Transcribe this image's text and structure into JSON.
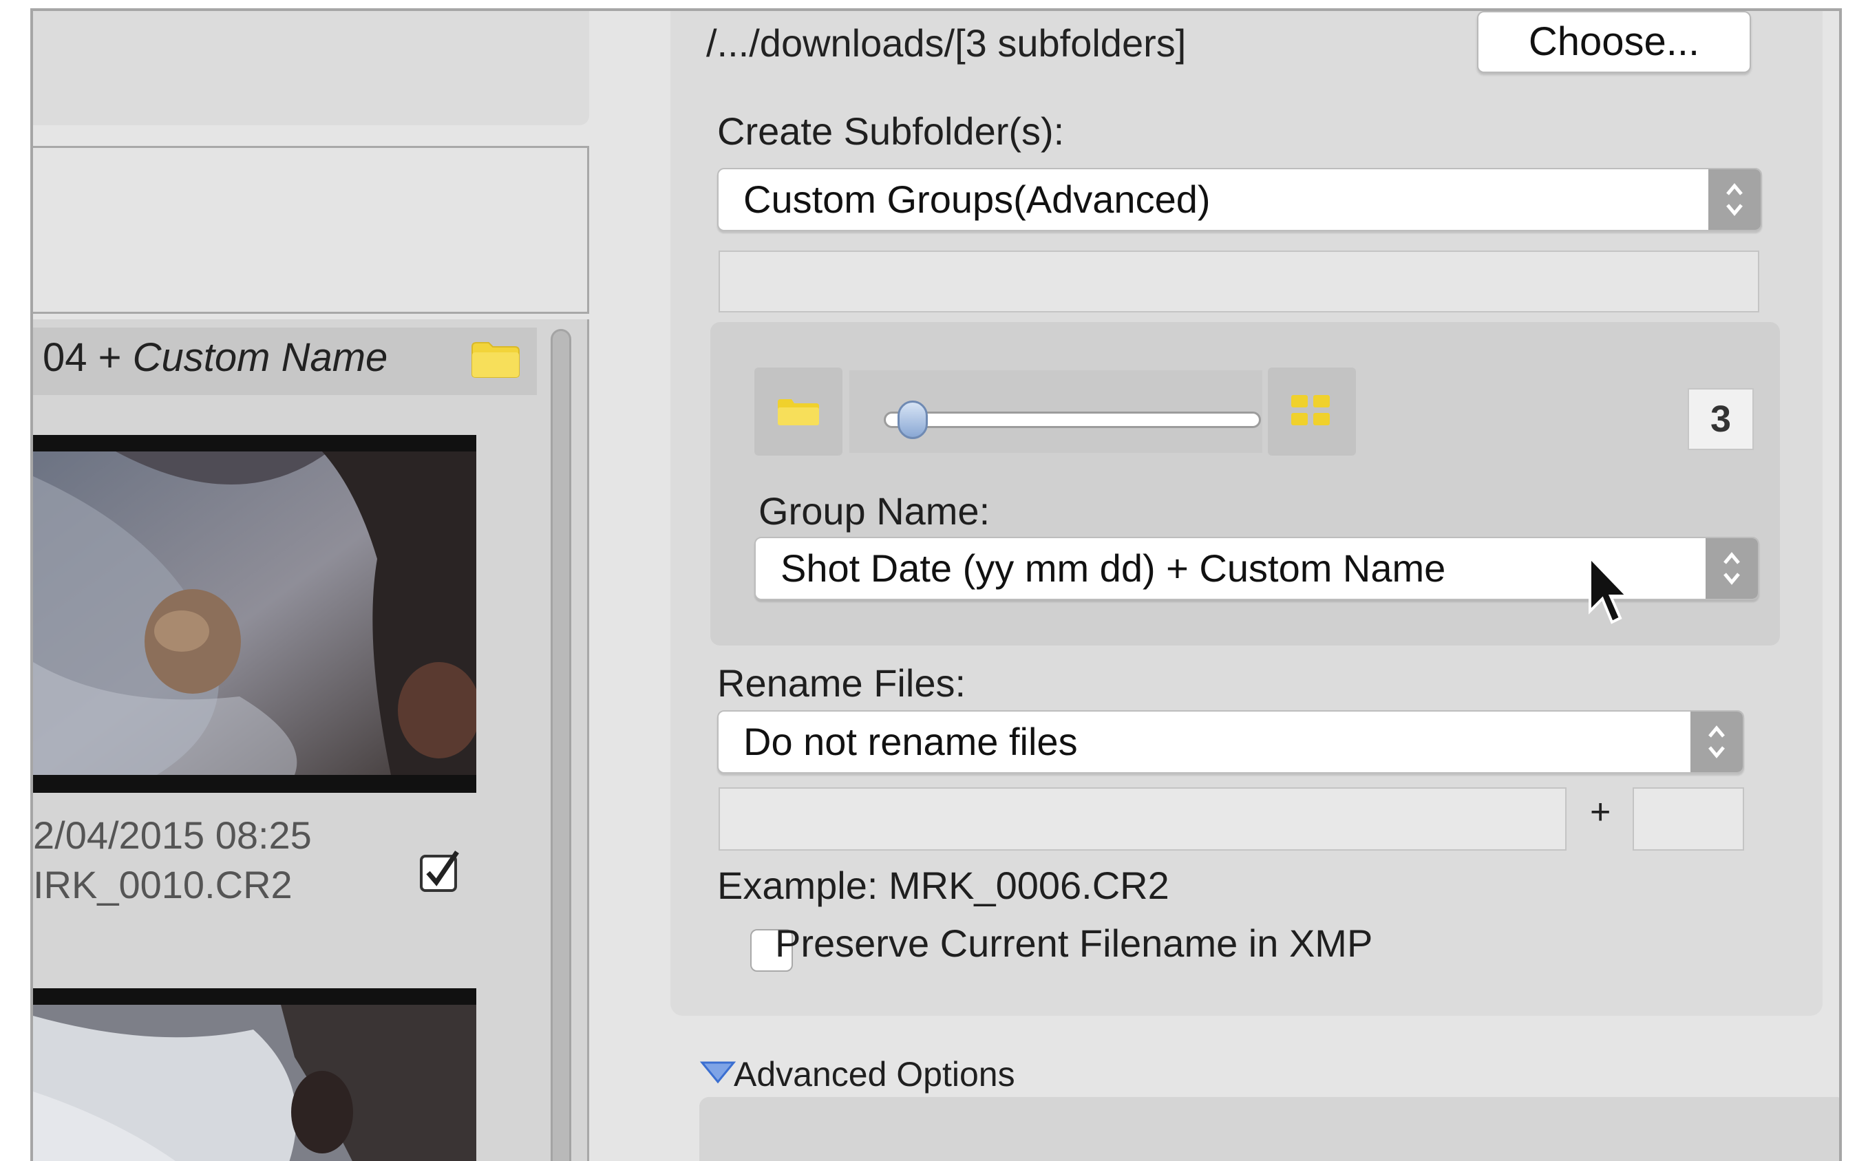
{
  "left_panel": {
    "group_header": {
      "date_fragment": "04",
      "separator": "+",
      "custom_name": "Custom Name",
      "icon": "folder-icon"
    },
    "items": [
      {
        "date_line": "2/04/2015 08:25",
        "filename": "IRK_0010.CR2",
        "checked": true
      }
    ]
  },
  "destination": {
    "path": "/.../downloads/[3 subfolders]",
    "choose_label": "Choose..."
  },
  "subfolders": {
    "label": "Create Subfolder(s):",
    "selected": "Custom Groups(Advanced)",
    "group_count": "3",
    "level": 0.05,
    "group_name_label": "Group Name:",
    "group_name_selected": "Shot Date (yy mm dd) + Custom Name"
  },
  "rename": {
    "label": "Rename Files:",
    "selected": "Do not rename files",
    "plus": "+",
    "example": "Example:  MRK_0006.CR2",
    "preserve_label": "Preserve Current Filename in XMP",
    "preserve_checked": false
  },
  "advanced": {
    "label": "Advanced Options"
  },
  "colors": {
    "panel_bg": "#e5e5e5",
    "accent_blue": "#3b6fd1",
    "folder_yellow": "#f2d43a"
  }
}
